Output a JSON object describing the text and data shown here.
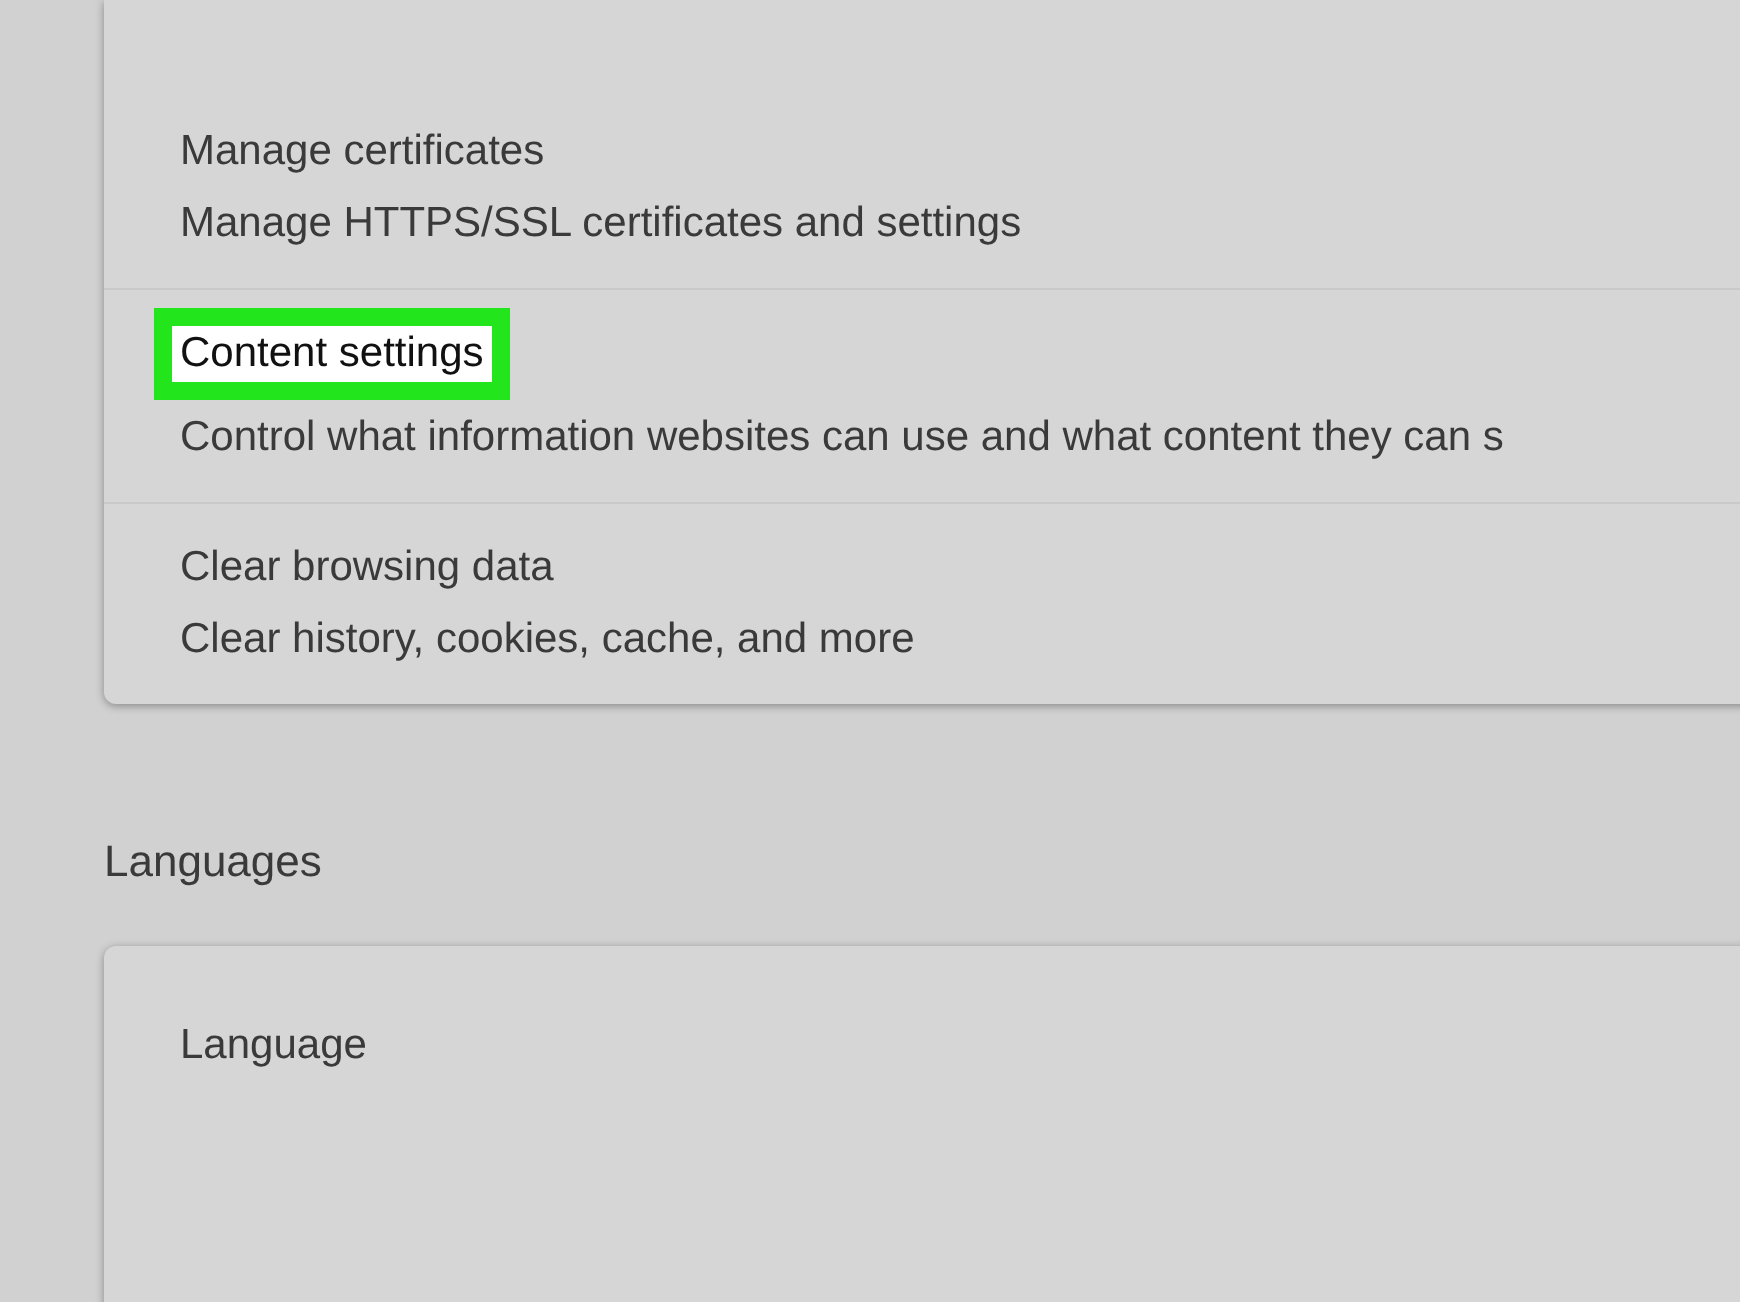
{
  "privacy_items": [
    {
      "title": "Manage certificates",
      "description": "Manage HTTPS/SSL certificates and settings",
      "highlighted": false
    },
    {
      "title": "Content settings",
      "description": "Control what information websites can use and what content they can s",
      "highlighted": true
    },
    {
      "title": "Clear browsing data",
      "description": "Clear history, cookies, cache, and more",
      "highlighted": false
    }
  ],
  "languages": {
    "heading": "Languages",
    "items": [
      {
        "title": "Language"
      }
    ]
  }
}
